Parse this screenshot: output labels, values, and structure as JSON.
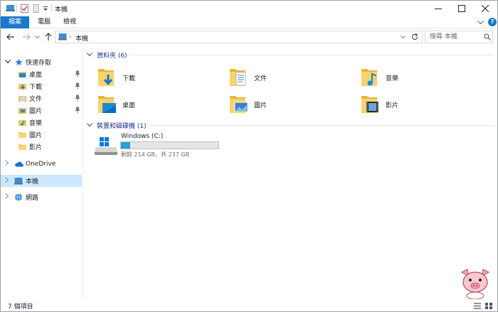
{
  "window": {
    "title": "本機"
  },
  "ribbon": {
    "tabs": [
      {
        "label": "檔案"
      },
      {
        "label": "電腦"
      },
      {
        "label": "檢視"
      }
    ]
  },
  "address": {
    "path": "本機",
    "search_placeholder": "搜尋 本機"
  },
  "nav": {
    "quick_access": "快速存取",
    "quick_items": [
      {
        "label": "桌面",
        "pinned": true
      },
      {
        "label": "下載",
        "pinned": true
      },
      {
        "label": "文件",
        "pinned": true
      },
      {
        "label": "圖片",
        "pinned": true
      },
      {
        "label": "音樂",
        "pinned": false
      },
      {
        "label": "圖片",
        "pinned": false
      },
      {
        "label": "影片",
        "pinned": false
      }
    ],
    "onedrive": "OneDrive",
    "this_pc": "本機",
    "network": "網路"
  },
  "content": {
    "folders_header": "資料夾 (6)",
    "folders": [
      {
        "label": "下載",
        "icon": "downloads-folder-icon"
      },
      {
        "label": "文件",
        "icon": "documents-folder-icon"
      },
      {
        "label": "音樂",
        "icon": "music-folder-icon"
      },
      {
        "label": "桌面",
        "icon": "desktop-folder-icon"
      },
      {
        "label": "圖片",
        "icon": "pictures-folder-icon"
      },
      {
        "label": "影片",
        "icon": "videos-folder-icon"
      }
    ],
    "devices_header": "裝置和磁碟機 (1)",
    "drive": {
      "name": "Windows (C:)",
      "free_text": "剩餘 214 GB，共 237 GB",
      "used_fraction": 0.097
    }
  },
  "status": {
    "items": "7 個項目"
  },
  "colors": {
    "accent": "#1979ca",
    "drive_bar": "#26a0da",
    "selected": "#cce8ff",
    "header": "#1e3287"
  }
}
